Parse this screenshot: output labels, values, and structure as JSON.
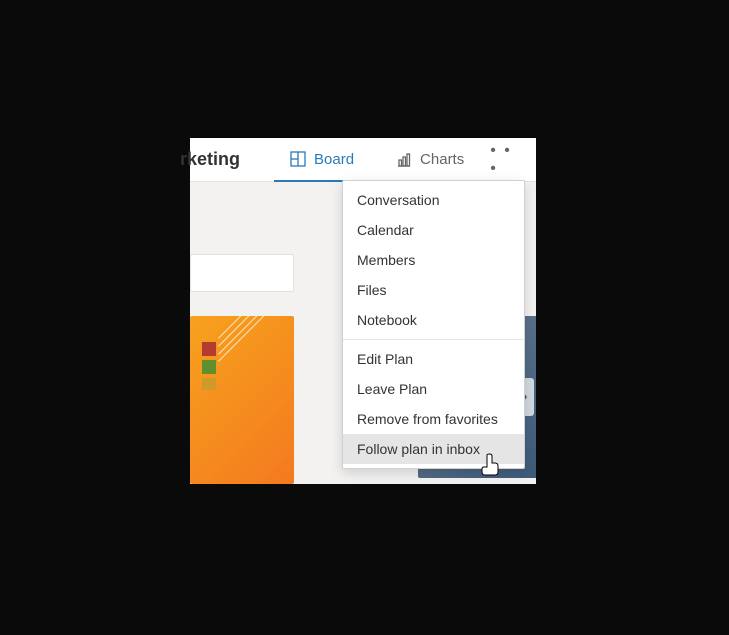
{
  "header": {
    "plan_title_fragment": "rketing",
    "tabs": {
      "board": "Board",
      "charts": "Charts"
    },
    "ellipsis": "• • •"
  },
  "dropdown": {
    "section1": [
      {
        "label": "Conversation"
      },
      {
        "label": "Calendar"
      },
      {
        "label": "Members"
      },
      {
        "label": "Files"
      },
      {
        "label": "Notebook"
      }
    ],
    "section2": [
      {
        "label": "Edit Plan"
      },
      {
        "label": "Leave Plan"
      },
      {
        "label": "Remove from favorites"
      },
      {
        "label": "Follow plan in inbox",
        "hover": true
      }
    ]
  }
}
